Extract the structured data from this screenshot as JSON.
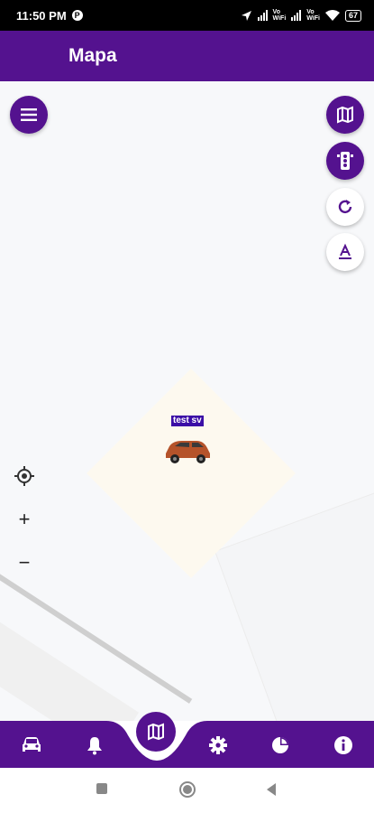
{
  "status_bar": {
    "time": "11:50 PM",
    "notification_icon": "P",
    "vo_label_1": "Vo\nWiFi",
    "vo_label_2": "Vo\nWiFi",
    "battery": "67"
  },
  "app_bar": {
    "title": "Mapa"
  },
  "map": {
    "vehicle_label": "test sv",
    "controls": [
      "my-location",
      "zoom-in",
      "zoom-out"
    ],
    "zoom_in_label": "+",
    "zoom_out_label": "−"
  },
  "colors": {
    "primary": "#54128f",
    "label_bg": "#3b0ea6",
    "map_bg": "#f7f8fa"
  },
  "bottom_nav": {
    "items": [
      "car-icon",
      "bell-icon",
      "map-icon",
      "gear-icon",
      "pie-chart-icon",
      "info-icon"
    ],
    "active": "map-icon"
  },
  "system_nav": {
    "buttons": [
      "recents",
      "home",
      "back"
    ]
  }
}
